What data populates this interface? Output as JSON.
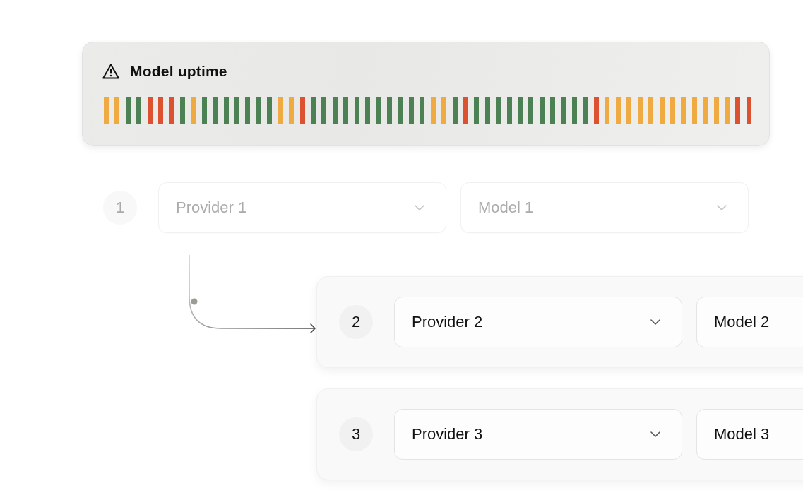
{
  "uptime_card": {
    "title": "Model uptime",
    "bars": [
      {
        "color": "#f0aa42"
      },
      {
        "color": "#f0aa42"
      },
      {
        "color": "#4b8153"
      },
      {
        "color": "#4b8153"
      },
      {
        "color": "#dc5230"
      },
      {
        "color": "#dc5230"
      },
      {
        "color": "#dc5230"
      },
      {
        "color": "#4b8153"
      },
      {
        "color": "#f0aa42"
      },
      {
        "color": "#4b8153"
      },
      {
        "color": "#4b8153"
      },
      {
        "color": "#4b8153"
      },
      {
        "color": "#4b8153"
      },
      {
        "color": "#4b8153"
      },
      {
        "color": "#4b8153"
      },
      {
        "color": "#4b8153"
      },
      {
        "color": "#f0aa42"
      },
      {
        "color": "#f0aa42"
      },
      {
        "color": "#dc5230"
      },
      {
        "color": "#4b8153"
      },
      {
        "color": "#4b8153"
      },
      {
        "color": "#4b8153"
      },
      {
        "color": "#4b8153"
      },
      {
        "color": "#4b8153"
      },
      {
        "color": "#4b8153"
      },
      {
        "color": "#4b8153"
      },
      {
        "color": "#4b8153"
      },
      {
        "color": "#4b8153"
      },
      {
        "color": "#4b8153"
      },
      {
        "color": "#4b8153"
      },
      {
        "color": "#f0aa42"
      },
      {
        "color": "#f0aa42"
      },
      {
        "color": "#4b8153"
      },
      {
        "color": "#dc5230"
      },
      {
        "color": "#4b8153"
      },
      {
        "color": "#4b8153"
      },
      {
        "color": "#4b8153"
      },
      {
        "color": "#4b8153"
      },
      {
        "color": "#4b8153"
      },
      {
        "color": "#4b8153"
      },
      {
        "color": "#4b8153"
      },
      {
        "color": "#4b8153"
      },
      {
        "color": "#4b8153"
      },
      {
        "color": "#4b8153"
      },
      {
        "color": "#4b8153"
      },
      {
        "color": "#dc5230"
      },
      {
        "color": "#f0aa42"
      },
      {
        "color": "#f0aa42"
      },
      {
        "color": "#f0aa42"
      },
      {
        "color": "#f0aa42"
      },
      {
        "color": "#f0aa42"
      },
      {
        "color": "#f0aa42"
      },
      {
        "color": "#f0aa42"
      },
      {
        "color": "#f0aa42"
      },
      {
        "color": "#f0aa42"
      },
      {
        "color": "#f0aa42"
      },
      {
        "color": "#f0aa42"
      },
      {
        "color": "#f0aa42"
      },
      {
        "color": "#dc5230"
      },
      {
        "color": "#dc5230"
      }
    ]
  },
  "primary": {
    "number": "1",
    "provider": "Provider 1",
    "model": "Model 1",
    "disabled": true
  },
  "fallbacks": [
    {
      "number": "2",
      "provider": "Provider 2",
      "model": "Model 2",
      "disabled": false
    },
    {
      "number": "3",
      "provider": "Provider 3",
      "model": "Model 3",
      "disabled": false
    }
  ]
}
